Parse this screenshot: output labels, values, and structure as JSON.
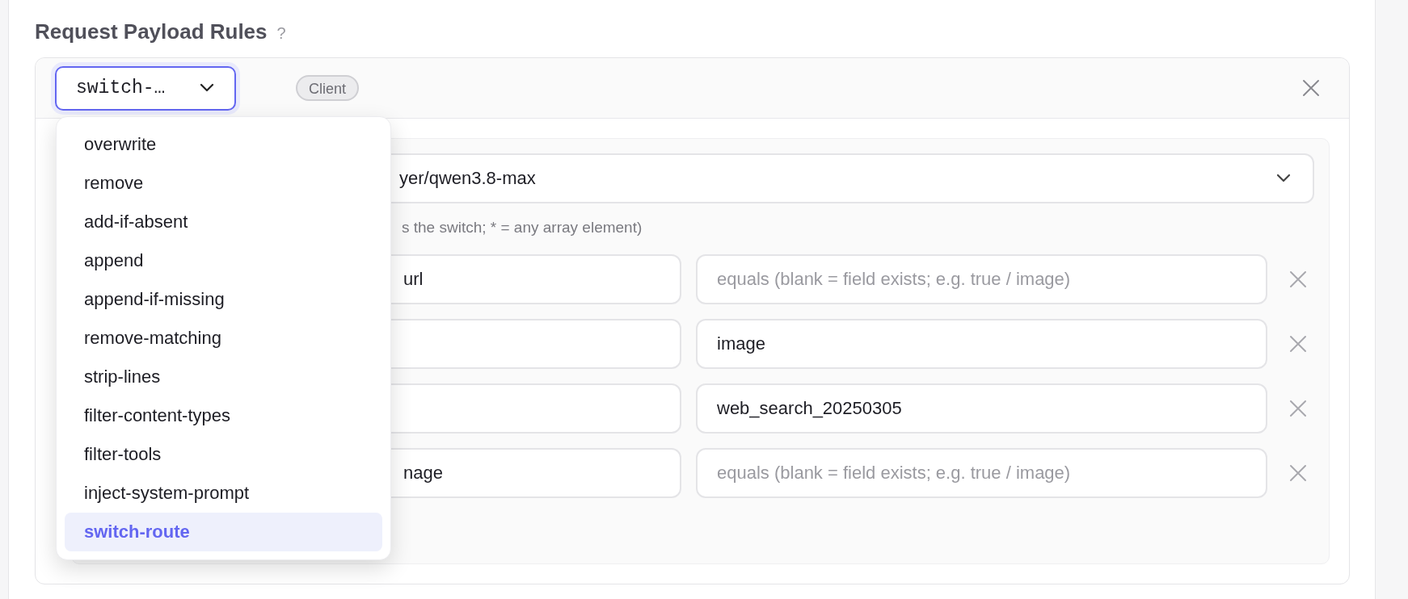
{
  "section": {
    "title": "Request Payload Rules",
    "help": "?"
  },
  "rule": {
    "operation": {
      "value": "switch-…",
      "expanded": true
    },
    "source_badge": "Client",
    "menu": [
      {
        "label": "overwrite",
        "selected": false
      },
      {
        "label": "remove",
        "selected": false
      },
      {
        "label": "add-if-absent",
        "selected": false
      },
      {
        "label": "append",
        "selected": false
      },
      {
        "label": "append-if-missing",
        "selected": false
      },
      {
        "label": "remove-matching",
        "selected": false
      },
      {
        "label": "strip-lines",
        "selected": false
      },
      {
        "label": "filter-content-types",
        "selected": false
      },
      {
        "label": "filter-tools",
        "selected": false
      },
      {
        "label": "inject-system-prompt",
        "selected": false
      },
      {
        "label": "switch-route",
        "selected": true
      }
    ],
    "route": {
      "value": "yer/qwen3.8-max"
    },
    "hint": "s the switch; * = any array element)",
    "conditions": [
      {
        "path": "url",
        "placeholder": "equals (blank = field exists; e.g. true / image)"
      },
      {
        "value": "image"
      },
      {
        "value": "web_search_20250305"
      },
      {
        "path": "nage",
        "placeholder": "equals (blank = field exists; e.g. true / image)"
      }
    ]
  }
}
